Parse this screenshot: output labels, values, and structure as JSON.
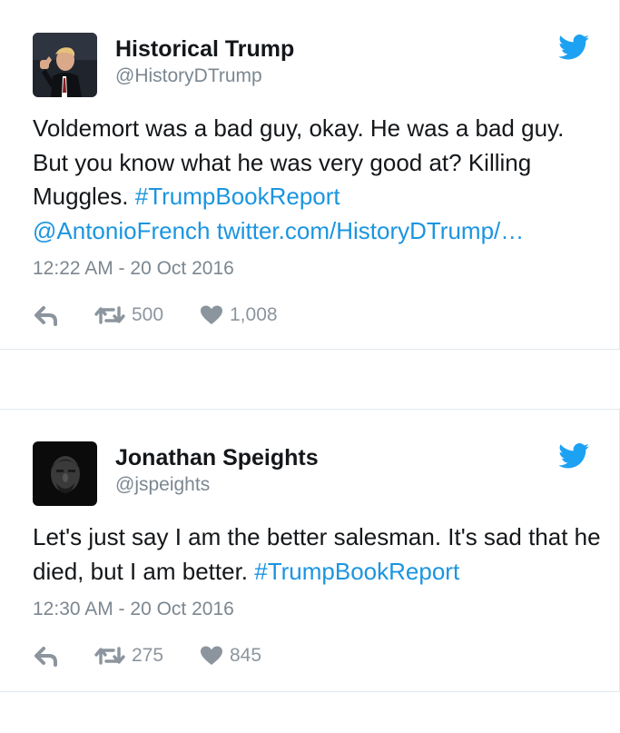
{
  "tweets": [
    {
      "name": "Historical Trump",
      "handle": "@HistoryDTrump",
      "text_plain": "Voldemort was a bad guy, okay. He was a bad guy. But you know what he was very good at? Killing Muggles. ",
      "hashtag": "#TrumpBookReport",
      "mention": "@AntonioFrench",
      "url": "twitter.com/HistoryDTrump/…",
      "timestamp": "12:22 AM - 20 Oct 2016",
      "retweets": "500",
      "likes": "1,008",
      "avatar_icon": "man-at-podium-avatar"
    },
    {
      "name": "Jonathan Speights",
      "handle": "@jspeights",
      "text_plain": "Let's just say I am the better salesman. It's sad that he died, but I am better. ",
      "hashtag": "#TrumpBookReport",
      "timestamp": "12:30 AM - 20 Oct 2016",
      "retweets": "275",
      "likes": "845",
      "avatar_icon": "dark-portrait-avatar"
    }
  ],
  "icons": {
    "brand": "twitter-bird-icon",
    "reply": "reply-icon",
    "retweet": "retweet-icon",
    "like": "heart-icon"
  },
  "colors": {
    "brand_blue": "#1da1f2",
    "link_blue": "#1b95e0",
    "text": "#14171a",
    "muted": "#7c8791",
    "action_gray": "#8c959e",
    "divider": "#e1e8ed"
  }
}
